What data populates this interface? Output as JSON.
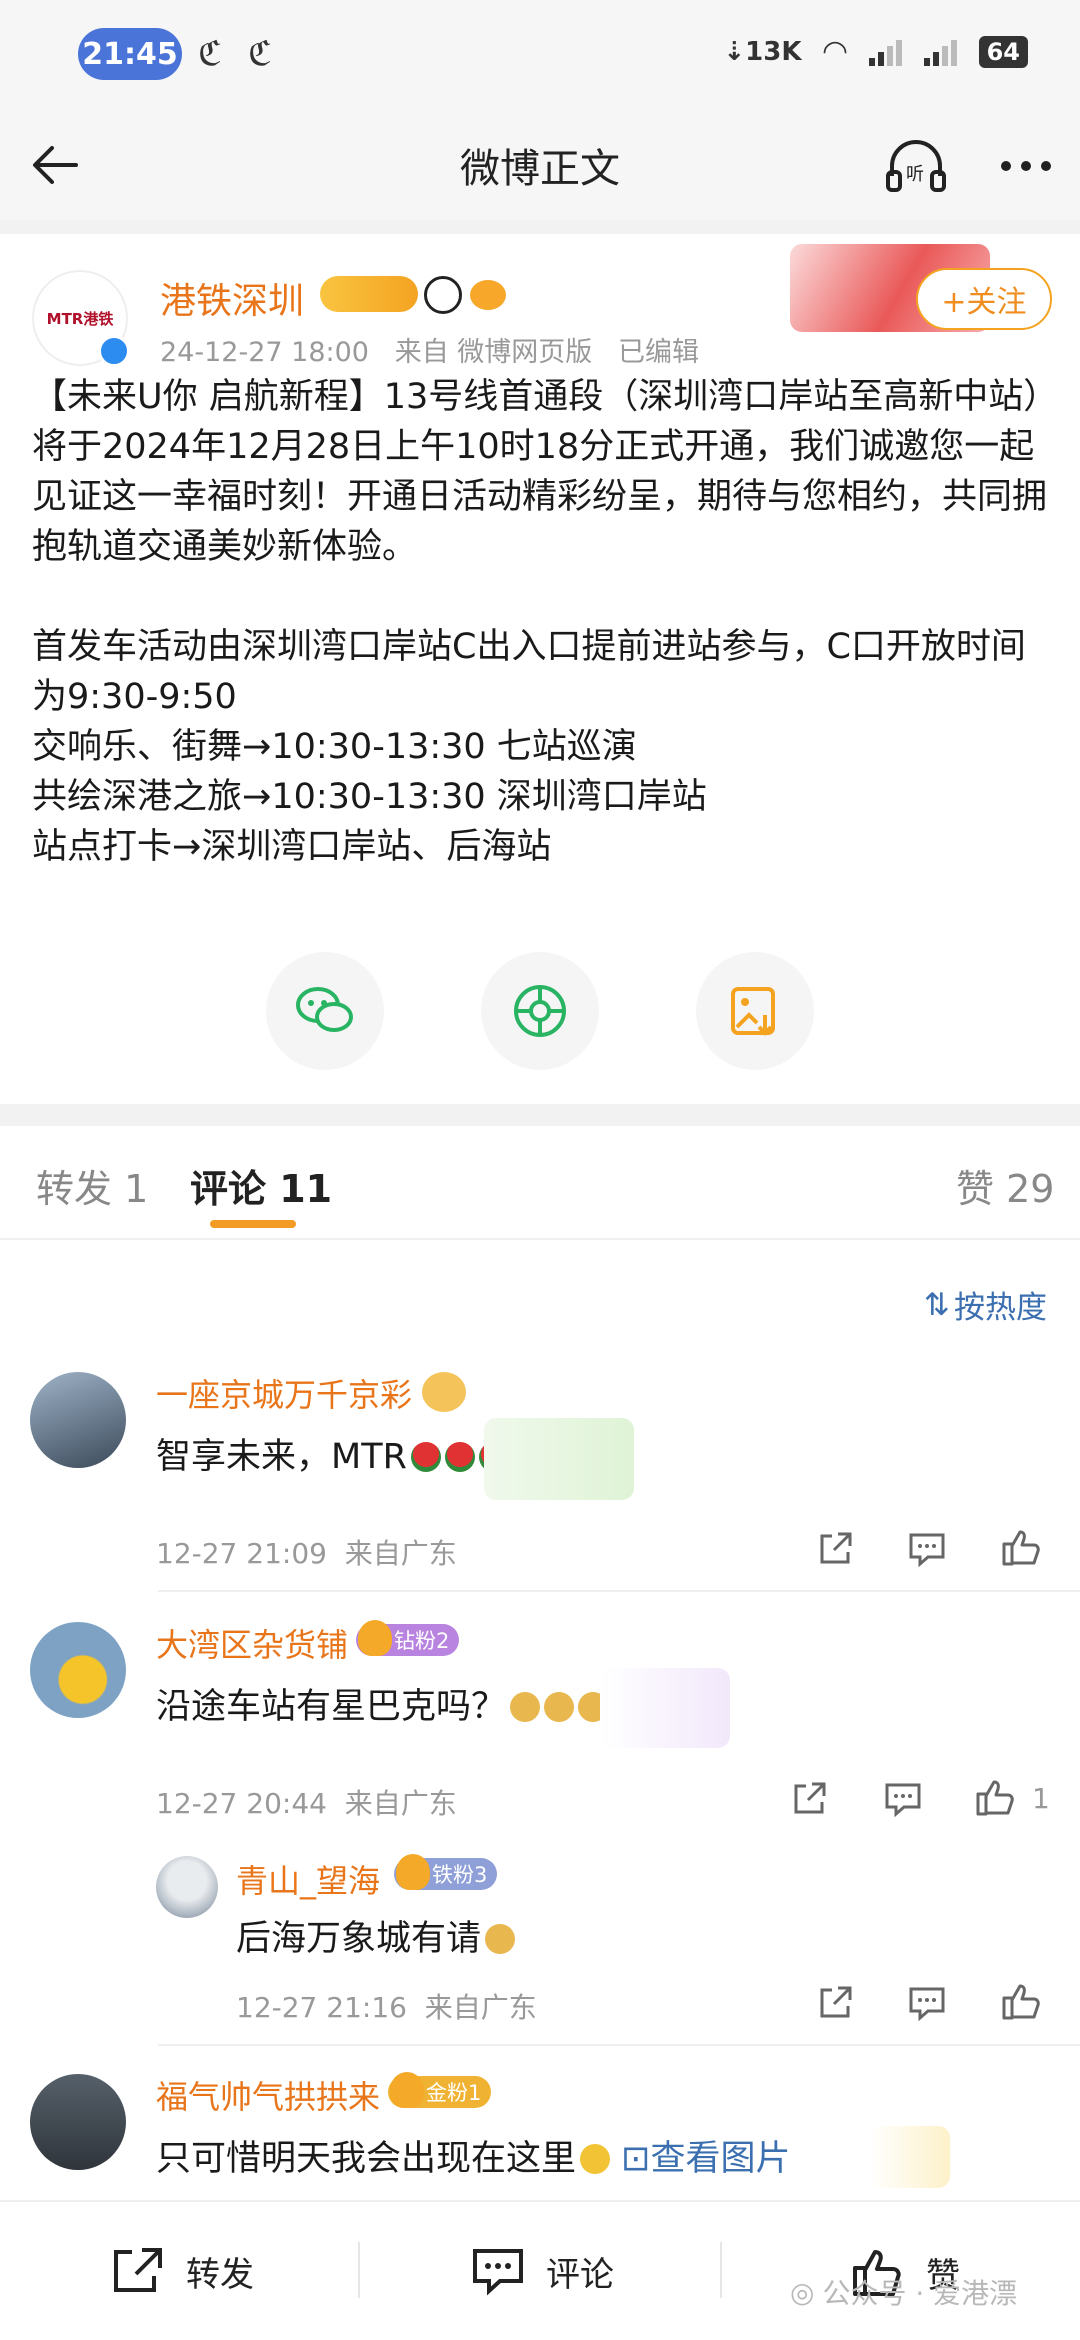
{
  "status_bar": {
    "time": "21:45",
    "net_speed": "13K",
    "battery": "64"
  },
  "nav": {
    "title": "微博正文"
  },
  "post": {
    "author": "港铁深圳",
    "avatar_text": "MTR港铁",
    "date": "24-12-27 18:00",
    "source": "来自 微博网页版",
    "edited": "已编辑",
    "follow_label": "+关注",
    "paragraphs": [
      "【未来U你 启航新程】13号线首通段（深圳湾口岸站至高新中站）将于2024年12月28日上午10时18分正式开通，我们诚邀您一起见证这一幸福时刻！开通日活动精彩纷呈，期待与您相约，共同拥抱轨道交通美妙新体验。",
      "",
      "首发车活动由深圳湾口岸站C出入口提前进站参与，C口开放时间为9:30-9:50",
      "交响乐、街舞→10:30-13:30 七站巡演",
      "共绘深港之旅→10:30-13:30 深圳湾口岸站",
      "站点打卡→深圳湾口岸站、后海站"
    ]
  },
  "share_icons": [
    "wechat-icon",
    "moments-icon",
    "save-image-icon"
  ],
  "tabs": {
    "repost": "转发 1",
    "comments": "评论 11",
    "likes": "赞 29"
  },
  "sort_label": "按热度",
  "comments": [
    {
      "name": "一座京城万千京彩",
      "text": "智享未来，MTR",
      "time": "12-27 21:09",
      "location": "来自广东",
      "likes": ""
    },
    {
      "name": "大湾区杂货铺",
      "badge": "钻粉2",
      "text": "沿途车站有星巴克吗？",
      "time": "12-27 20:44",
      "location": "来自广东",
      "likes": "1"
    },
    {
      "name": "青山_望海",
      "badge": "铁粉3",
      "text": "后海万象城有请",
      "time": "12-27 21:16",
      "location": "来自广东",
      "likes": ""
    },
    {
      "name": "福气帅气拱拱来",
      "badge": "金粉1",
      "text": "只可惜明天我会出现在这里",
      "link": "查看图片"
    }
  ],
  "bottom_bar": {
    "repost": "转发",
    "comment": "评论",
    "like": "赞"
  },
  "watermark": "公众号 · 爱港漂",
  "colors": {
    "accent_orange": "#f29b25",
    "name_orange": "#e8751a",
    "link_blue": "#3b6fb0",
    "time_pill": "#4b74d9"
  }
}
